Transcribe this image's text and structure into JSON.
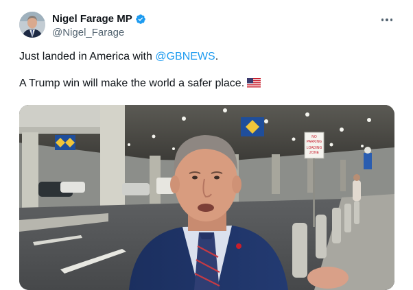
{
  "author": {
    "display_name": "Nigel Farage MP",
    "handle": "@Nigel_Farage",
    "verified": true,
    "verified_color": "#1d9bf0"
  },
  "tweet": {
    "text_before_mention": "Just landed in America with ",
    "mention": "@GBNEWS",
    "text_after_mention": ".",
    "line2": "A Trump win will make the world a safer place.",
    "emoji": "us-flag"
  },
  "media": {
    "sign_no_parking": [
      "NO",
      "PARKING",
      "LOADING",
      "ZONE"
    ]
  },
  "icons": {
    "more": "more-horizontal-icon",
    "verified": "verified-badge-icon",
    "flag": "us-flag-icon"
  },
  "colors": {
    "link": "#1d9bf0",
    "text": "#0f1419",
    "secondary": "#536471"
  }
}
